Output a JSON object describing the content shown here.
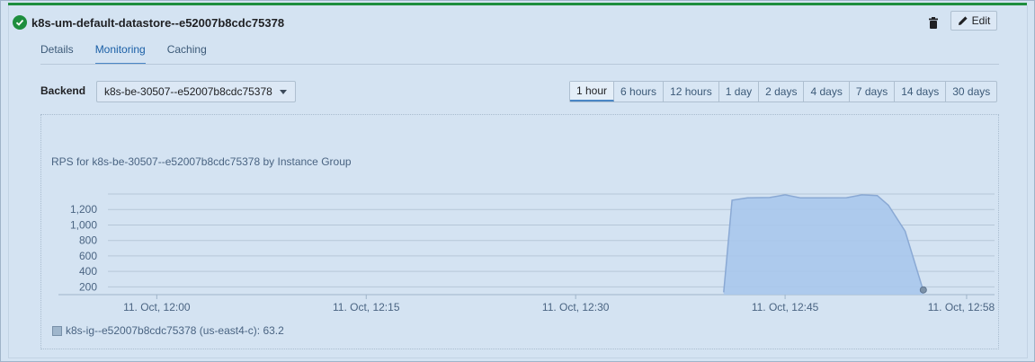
{
  "header": {
    "title": "k8s-um-default-datastore--e52007b8cdc75378",
    "edit_label": "Edit"
  },
  "tabs": [
    {
      "label": "Details"
    },
    {
      "label": "Monitoring"
    },
    {
      "label": "Caching"
    }
  ],
  "backend": {
    "label": "Backend",
    "selected": "k8s-be-30507--e52007b8cdc75378"
  },
  "time_ranges": [
    "1 hour",
    "6 hours",
    "12 hours",
    "1 day",
    "2 days",
    "4 days",
    "7 days",
    "14 days",
    "30 days"
  ],
  "active_time_range": "1 hour",
  "colors": {
    "accent": "#1e8e3e",
    "series_fill": "#a8c7ec",
    "series_line": "#8aa9d4"
  },
  "chart_data": {
    "type": "area",
    "title": "RPS for k8s-be-30507--e52007b8cdc75378 by Instance Group",
    "y_ticks": [
      "200",
      "400",
      "600",
      "800",
      "1,000",
      "1,200"
    ],
    "x_ticks": [
      "11. Oct, 12:00",
      "11. Oct, 12:15",
      "11. Oct, 12:30",
      "11. Oct, 12:45",
      "11. Oct, 12:58"
    ],
    "ylim": [
      100,
      1400
    ],
    "xlim_minutes": [
      -3.5,
      60
    ],
    "series": [
      {
        "name": "k8s-ig--e52007b8cdc75378 (us-east4-c)",
        "x_minutes": [
          40.6,
          41.2,
          42.3,
          43.9,
          45.0,
          46.1,
          47.7,
          49.4,
          50.5,
          51.6,
          52.4,
          53.6,
          54.9
        ],
        "values": [
          130,
          1320,
          1350,
          1355,
          1390,
          1350,
          1350,
          1352,
          1390,
          1380,
          1255,
          920,
          150
        ]
      }
    ],
    "legend": [
      {
        "label": "k8s-ig--e52007b8cdc75378 (us-east4-c): 63.2"
      }
    ]
  }
}
